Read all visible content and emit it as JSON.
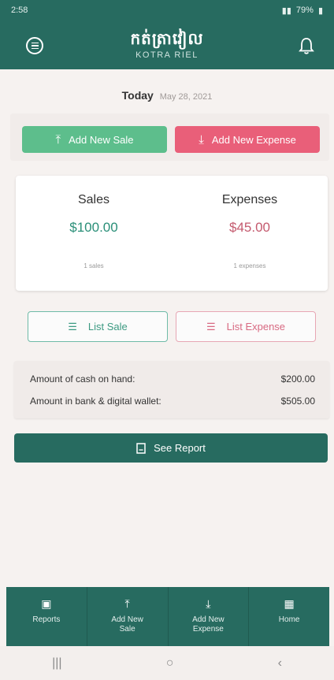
{
  "status_bar": {
    "time": "2:58",
    "battery": "79%"
  },
  "header": {
    "brand_khmer": "កត់ត្រាវៀល",
    "brand_latin": "KOTRA RIEL"
  },
  "date_row": {
    "today_label": "Today",
    "date": "May 28, 2021"
  },
  "actions": {
    "add_sale_label": "Add New Sale",
    "add_expense_label": "Add New Expense"
  },
  "summary": {
    "sales_label": "Sales",
    "sales_amount": "$100.00",
    "sales_count": "1 sales",
    "expenses_label": "Expenses",
    "expenses_amount": "$45.00",
    "expenses_count": "1 expenses"
  },
  "list_buttons": {
    "list_sale_label": "List Sale",
    "list_expense_label": "List Expense"
  },
  "cash": {
    "on_hand_label": "Amount of cash on hand:",
    "on_hand_value": "$200.00",
    "bank_label": "Amount in bank & digital wallet:",
    "bank_value": "$505.00"
  },
  "report_button_label": "See Report",
  "bottom_nav": {
    "items": [
      {
        "label": "Reports",
        "icon": "report-icon"
      },
      {
        "label": "Add New Sale",
        "icon": "arrow-up-icon"
      },
      {
        "label": "Add New Expense",
        "icon": "arrow-down-icon"
      },
      {
        "label": "Home",
        "icon": "home-icon"
      }
    ]
  },
  "colors": {
    "primary": "#276b60",
    "sale_green": "#5dbe8c",
    "expense_red": "#e95f79"
  }
}
